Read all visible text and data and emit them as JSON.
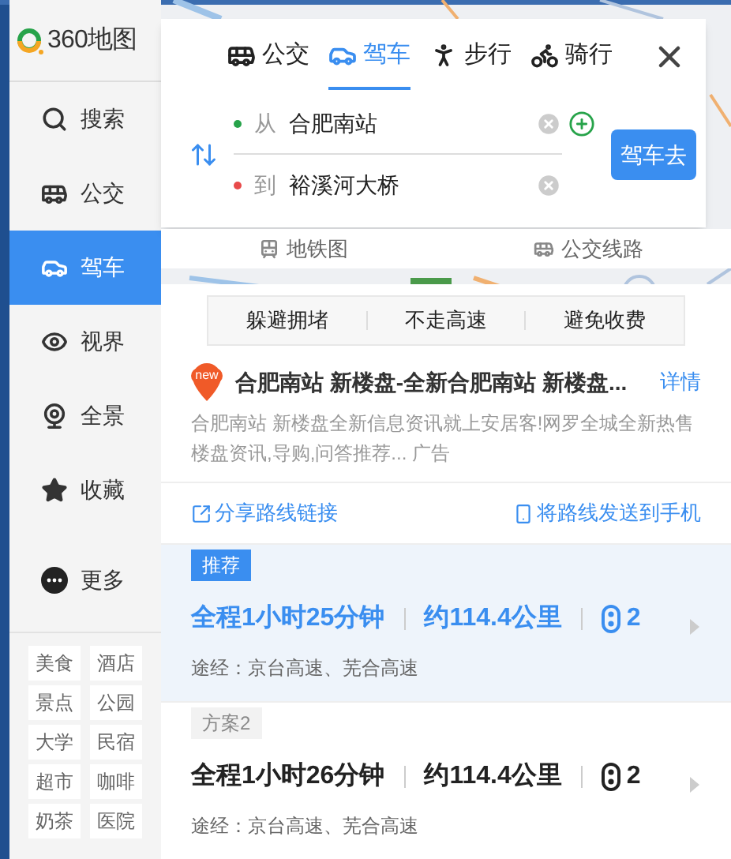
{
  "logo": {
    "text": "360地图"
  },
  "sidebar": {
    "items": [
      {
        "label": "搜索",
        "kind": "search",
        "selected": false
      },
      {
        "label": "公交",
        "kind": "bus",
        "selected": false
      },
      {
        "label": "驾车",
        "kind": "car",
        "selected": true
      },
      {
        "label": "视界",
        "kind": "eye",
        "selected": false
      },
      {
        "label": "全景",
        "kind": "camera",
        "selected": false
      },
      {
        "label": "收藏",
        "kind": "star",
        "selected": false
      },
      {
        "label": "更多",
        "kind": "more",
        "selected": false
      }
    ],
    "tags": [
      "美食",
      "酒店",
      "景点",
      "公园",
      "大学",
      "民宿",
      "超市",
      "咖啡",
      "奶茶",
      "医院"
    ]
  },
  "modes": [
    {
      "label": "公交",
      "kind": "bus",
      "selected": false
    },
    {
      "label": "驾车",
      "kind": "car",
      "selected": true
    },
    {
      "label": "步行",
      "kind": "walk",
      "selected": false
    },
    {
      "label": "骑行",
      "kind": "bike",
      "selected": false
    }
  ],
  "from": {
    "prefix": "从",
    "value": "合肥南站"
  },
  "to": {
    "prefix": "到",
    "value": "裕溪河大桥"
  },
  "go_button": "驾车去",
  "links": [
    {
      "label": "地铁图",
      "kind": "subway"
    },
    {
      "label": "公交线路",
      "kind": "bus"
    }
  ],
  "options": [
    "躲避拥堵",
    "不走高速",
    "避免收费"
  ],
  "ad": {
    "badge": "new",
    "title": "合肥南站 新楼盘-全新合肥南站 新楼盘...",
    "link": "详情",
    "description": "合肥南站 新楼盘全新信息资讯就上安居客!网罗全城全新热售楼盘资讯,导购,问答推荐... 广告"
  },
  "share": {
    "left": "分享路线链接",
    "right": "将路线发送到手机"
  },
  "routes": [
    {
      "tag": "推荐",
      "duration": "全程1小时25分钟",
      "distance": "约114.4公里",
      "lights": "2",
      "via": "途经：京台高速、芜合高速",
      "selected": true
    },
    {
      "tag": "方案2",
      "duration": "全程1小时26分钟",
      "distance": "约114.4公里",
      "lights": "2",
      "via": "途经：京台高速、芜合高速",
      "selected": false
    }
  ]
}
